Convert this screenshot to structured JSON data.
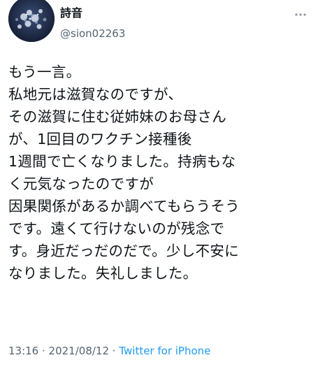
{
  "author": {
    "display_name": "詩音",
    "handle": "@sion02263",
    "avatar_icon": "avatar-dark-floral-icon"
  },
  "more_icon": "more-horizontal-icon",
  "tweet": {
    "lines": [
      "もう一言。",
      "私地元は滋賀なのですが、",
      "その滋賀に住む従姉妹のお母さん",
      "が、1回目のワクチン接種後",
      "1週間で亡くなりました。持病もな",
      "く元気なったのですが",
      "因果関係があるか調べてもらうそう",
      "です。遠くて行けないのが残念で",
      "す。身近だっだのだで。少し不安に",
      "なりました。失礼しました。"
    ]
  },
  "meta": {
    "time": "13:16",
    "separator": " · ",
    "date": "2021/08/12",
    "source": "Twitter for iPhone"
  },
  "colors": {
    "text": "#0f1419",
    "secondary": "#536471",
    "link": "#1d9bf0"
  }
}
